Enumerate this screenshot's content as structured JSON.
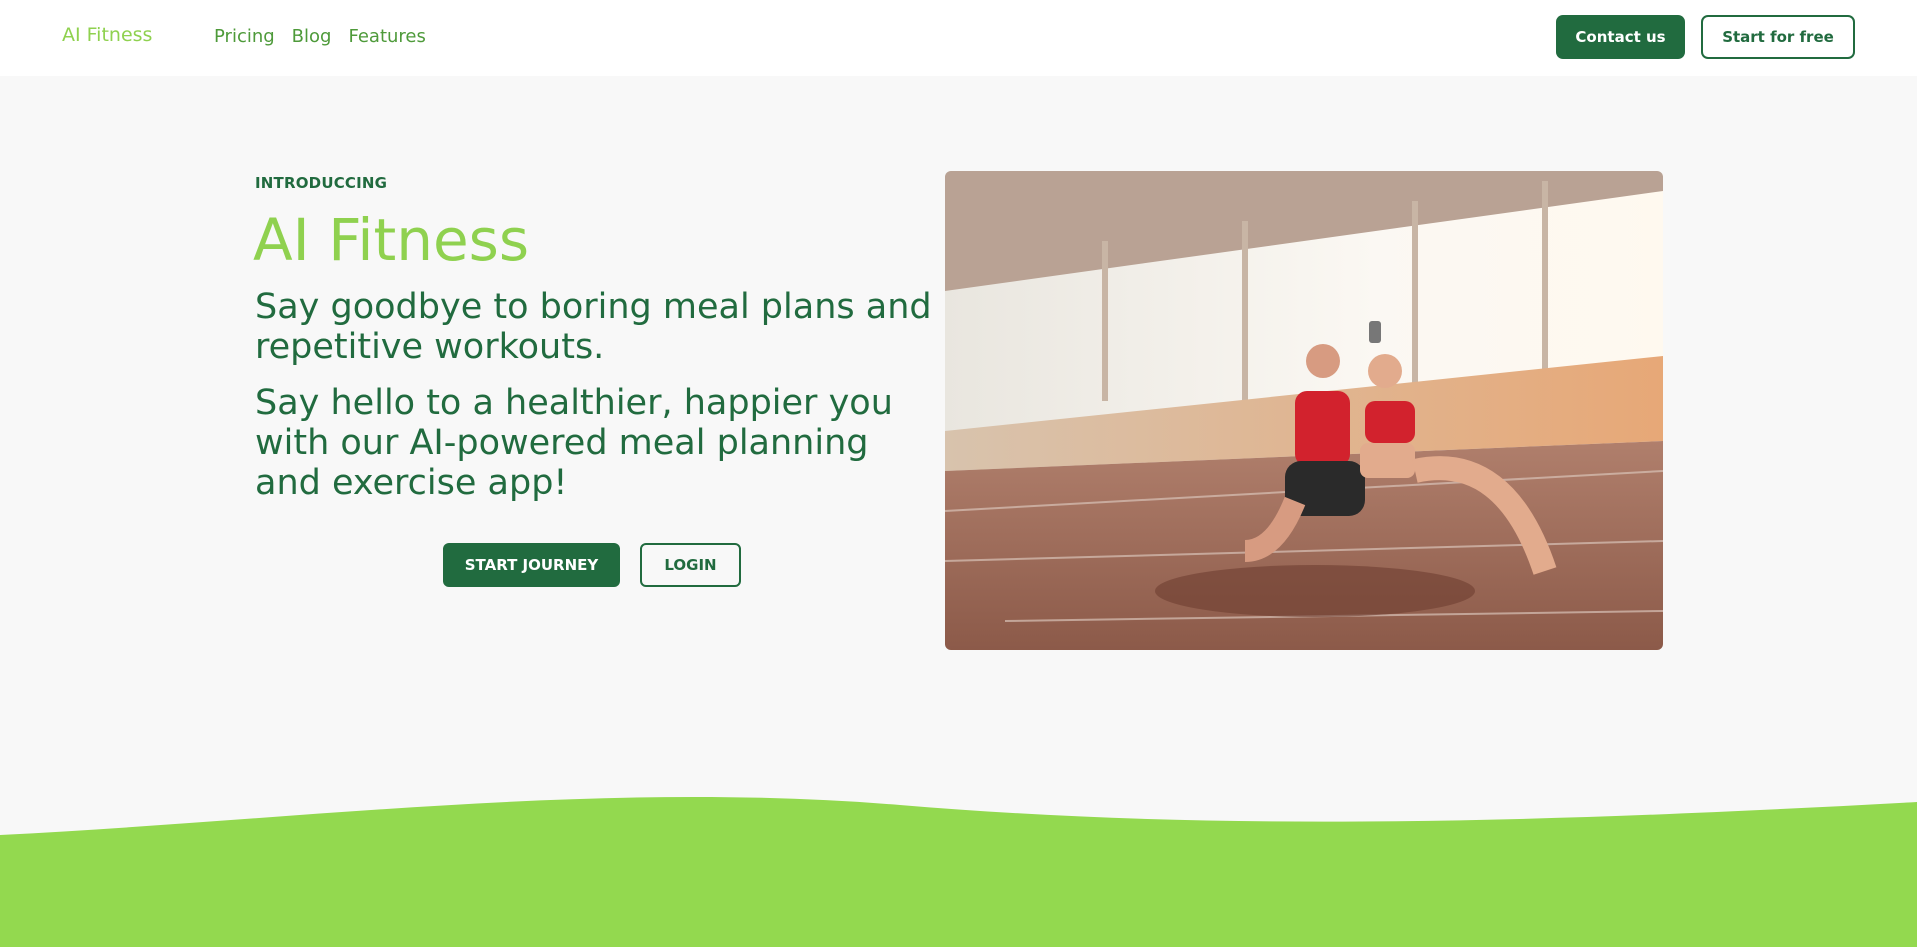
{
  "header": {
    "logo": "AI Fitness",
    "nav": [
      "Pricing",
      "Blog",
      "Features"
    ],
    "contact_label": "Contact us",
    "start_free_label": "Start for free"
  },
  "hero": {
    "eyebrow": "INTRODUCCING",
    "title": "AI Fitness",
    "paragraph1": "Say goodbye to boring meal plans and repetitive workouts.",
    "paragraph2": "Say hello to a healthier, happier you with our AI-powered meal planning and exercise app!",
    "start_journey_label": "START JOURNEY",
    "login_label": "LOGIN"
  },
  "image": {
    "icon": "hero-photo"
  },
  "colors": {
    "brand_dark": "#216b3f",
    "brand_light": "#8fd14f",
    "wave": "#93d94f",
    "background": "#f8f8f8"
  }
}
